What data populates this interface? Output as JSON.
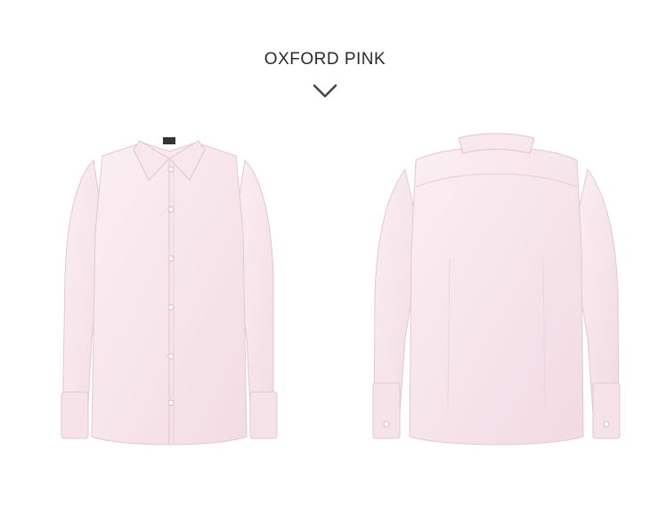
{
  "product": {
    "color_name": "OXFORD PINK",
    "expand_icon": "chevron-down-icon",
    "shirt_color": "#f6e3ea",
    "images": [
      {
        "view": "front"
      },
      {
        "view": "back"
      }
    ]
  }
}
